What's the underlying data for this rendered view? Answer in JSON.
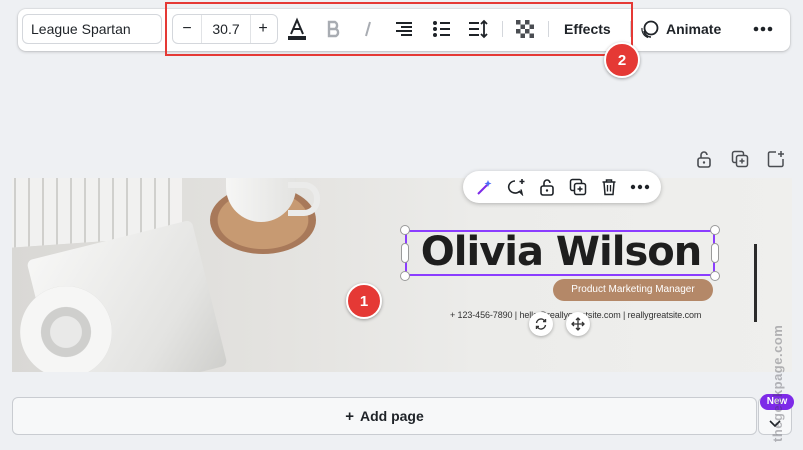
{
  "toolbar": {
    "font_family": "League Spartan",
    "size_decrease": "−",
    "font_size": "30.7",
    "size_increase": "+",
    "effects_label": "Effects",
    "animate_label": "Animate",
    "text_color": "#1f2328"
  },
  "annotations": {
    "badge_1": "1",
    "badge_2": "2",
    "color": "#e53935"
  },
  "canvas": {
    "name": "Olivia Wilson",
    "role": "Product Marketing Manager",
    "contact": "+ 123-456-7890  |  hello@reallygreatsite.com  |  reallygreatsite.com",
    "role_pill_color": "#b48868",
    "selection_color": "#8b3dff"
  },
  "add_page": {
    "label": "Add page",
    "plus": "+"
  },
  "new_badge": "New",
  "watermark": "thegeekpage.com"
}
